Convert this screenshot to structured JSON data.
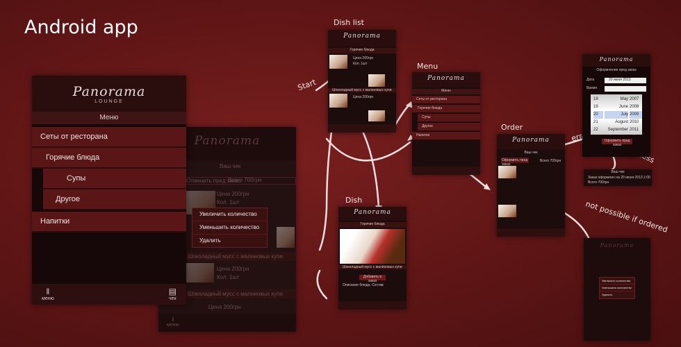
{
  "title": "Android app",
  "labels": {
    "dish_list": "Dish list",
    "menu": "Menu",
    "dish": "Dish",
    "order": "Order",
    "start": "Start",
    "error": "error",
    "success": "success",
    "not_possible": "not possible if ordered"
  },
  "main_screen": {
    "logo": "Panorama",
    "logo_sub": "LOUNGE",
    "menu_header": "Меню",
    "items": [
      "Сеты от ресторана",
      "Горячие блюда",
      "Супы",
      "Другое",
      "Напитки"
    ],
    "footer_left": "меню",
    "footer_right": "чек"
  },
  "behind_screen": {
    "rows": [
      "Ваш чек",
      "Всего 700грн",
      "Отменить пред заказ",
      "Цена 200грн",
      "Кол. 1шт",
      "Шоколадный мусс с малиновых купи",
      "Цена 200грн",
      "Кол. 1шт",
      "Шоколадный мусс с малиновых купи",
      "Цена 200грн"
    ],
    "popup": [
      "Увеличить количество",
      "Уменьшить количество",
      "Удалить"
    ]
  },
  "dish_list_screen": {
    "category": "Горячие блюда",
    "price": "Цена 200грн",
    "qty": "Кол. 1шт",
    "name": "Шоколадный мусс с малиновых купи"
  },
  "menu_screen": {
    "header": "Меню",
    "items": [
      "Сеты от ресторана",
      "Горячие блюда",
      "Супы",
      "Другое",
      "Напитки"
    ]
  },
  "dish_screen": {
    "category": "Горячие блюда",
    "name": "Шоколадный мусс с малиновых купи",
    "add_button": "Добавить в заказ",
    "desc": "Описание блюда. Состав"
  },
  "order_screen": {
    "check": "Ваш чек",
    "total": "Всего 700грн",
    "cancel": "Оформить пред заказ"
  },
  "date_screen": {
    "title": "Оформление пред заказ",
    "date_label": "Дата",
    "date_value": "20 июня 2013",
    "time_label": "Время",
    "days": [
      "18",
      "19",
      "20",
      "21",
      "22"
    ],
    "months": [
      "May",
      "June",
      "July",
      "August",
      "September"
    ],
    "years": [
      "2007",
      "2008",
      "2009",
      "2010",
      "2011"
    ],
    "button": "Оформить пред заказ"
  },
  "success_screen": {
    "check": "Ваш чек",
    "row1": "Заказ оформлен на",
    "row1_value": "20 июня 2013   1:00",
    "row2": "Всего 700грн"
  },
  "blocked_screen": {
    "popup": [
      "Увеличить количество",
      "Уменьшить количество",
      "Удалить"
    ]
  }
}
